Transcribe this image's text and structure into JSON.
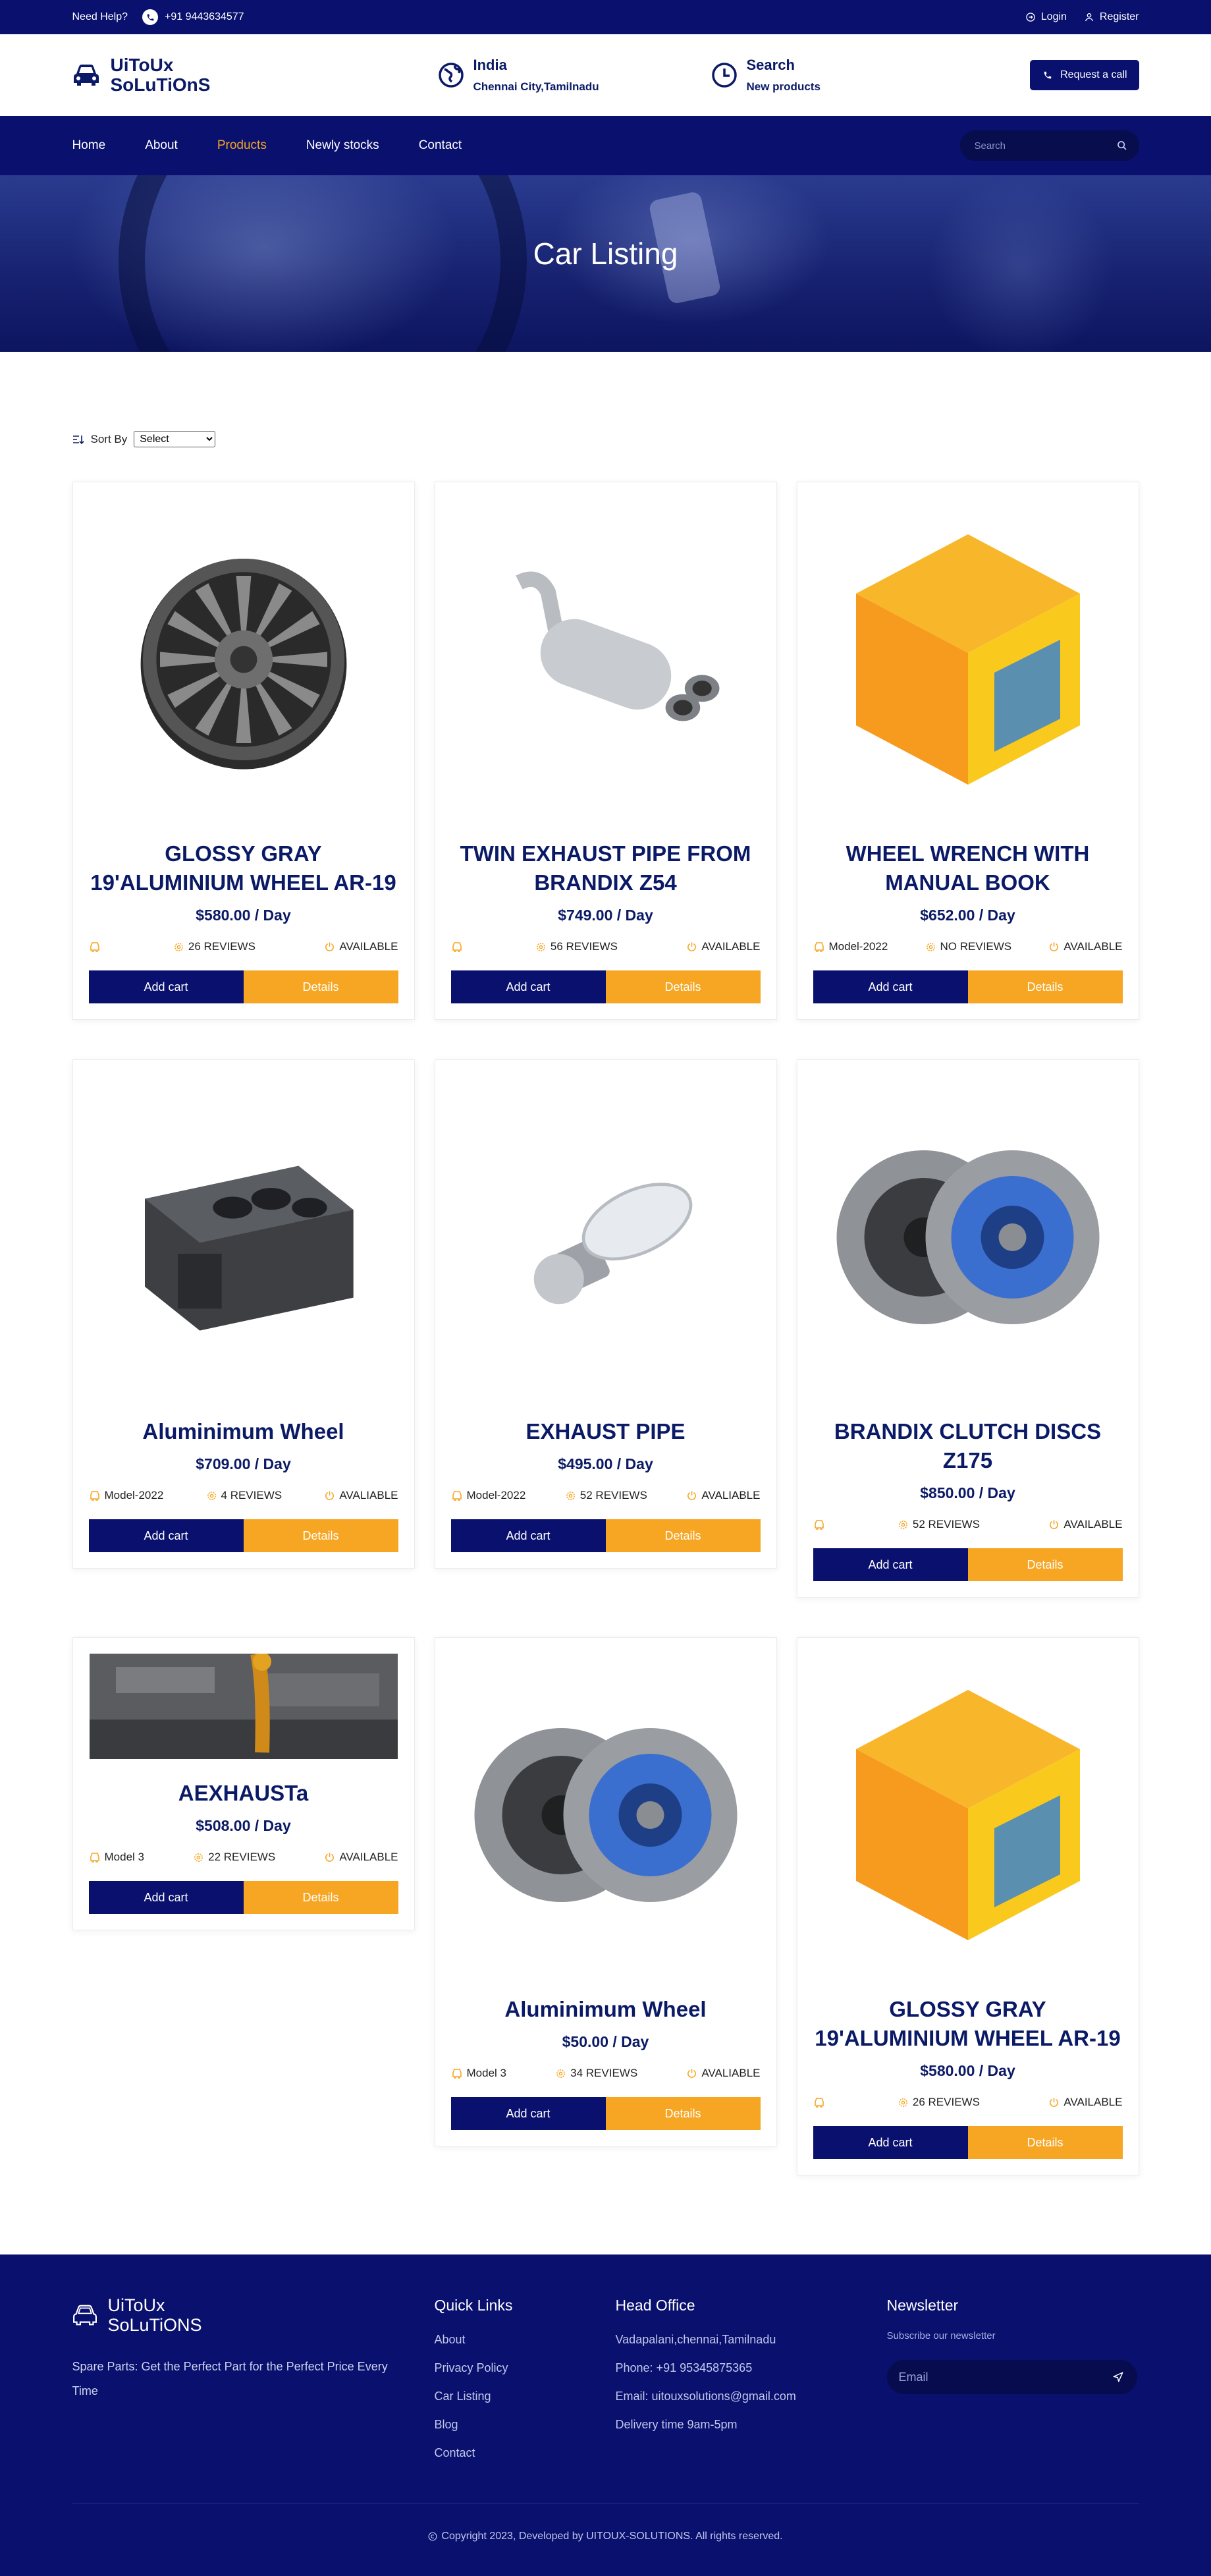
{
  "topbar": {
    "help_label": "Need Help?",
    "phone": "+91 9443634577",
    "login_label": "Login",
    "register_label": "Register"
  },
  "header": {
    "logo_line1": "UiToUx",
    "logo_line2": "SoLuTiOnS",
    "location_title": "India",
    "location_sub": "Chennai City,Tamilnadu",
    "search_title": "Search",
    "search_sub": "New products",
    "request_label": "Request a call"
  },
  "nav": {
    "items": [
      {
        "label": "Home",
        "active": false
      },
      {
        "label": "About",
        "active": false
      },
      {
        "label": "Products",
        "active": true
      },
      {
        "label": "Newly stocks",
        "active": false
      },
      {
        "label": "Contact",
        "active": false
      }
    ],
    "search_placeholder": "Search"
  },
  "banner": {
    "title": "Car Listing"
  },
  "sort": {
    "label": "Sort By",
    "selected": "Select"
  },
  "products": [
    {
      "name": "GLOSSY GRAY 19'ALUMINIUM WHEEL AR-19",
      "price": "$580.00 / Day",
      "model": "",
      "reviews": "26 REVIEWS",
      "status": "AVAILABLE",
      "image": "alloy-wheel"
    },
    {
      "name": "TWIN EXHAUST PIPE FROM BRANDIX Z54",
      "price": "$749.00 / Day",
      "model": "",
      "reviews": "56 REVIEWS",
      "status": "AVAILABLE",
      "image": "exhaust-pipe"
    },
    {
      "name": "WHEEL WRENCH WITH MANUAL BOOK",
      "price": "$652.00 / Day",
      "model": "Model-2022",
      "reviews": "NO REVIEWS",
      "status": "AVAILABLE",
      "image": "box-placeholder"
    },
    {
      "name": "Aluminimum Wheel",
      "price": "$709.00 / Day",
      "model": "Model-2022",
      "reviews": "4 REVIEWS",
      "status": "AVALIABLE",
      "image": "engine-block"
    },
    {
      "name": "EXHAUST PIPE",
      "price": "$495.00 / Day",
      "model": "Model-2022",
      "reviews": "52 REVIEWS",
      "status": "AVALIABLE",
      "image": "headlight-bulb"
    },
    {
      "name": "BRANDIX CLUTCH DISCS Z175",
      "price": "$850.00 / Day",
      "model": "",
      "reviews": "52 REVIEWS",
      "status": "AVAILABLE",
      "image": "clutch-discs"
    },
    {
      "name": "AEXHAUSTa",
      "price": "$508.00 / Day",
      "model": "Model 3",
      "reviews": "22 REVIEWS",
      "status": "AVAILABLE",
      "image": "engine-oil"
    },
    {
      "name": "Aluminimum Wheel",
      "price": "$50.00 / Day",
      "model": "Model 3",
      "reviews": "34 REVIEWS",
      "status": "AVALIABLE",
      "image": "clutch-discs"
    },
    {
      "name": "GLOSSY GRAY 19'ALUMINIUM WHEEL AR-19",
      "price": "$580.00 / Day",
      "model": "",
      "reviews": "26 REVIEWS",
      "status": "AVAILABLE",
      "image": "box-placeholder"
    }
  ],
  "buttons": {
    "add_cart": "Add cart",
    "details": "Details"
  },
  "footer": {
    "logo_line1": "UiToUx",
    "logo_line2": "SoLuTiONS",
    "description": "Spare Parts: Get the Perfect Part for the Perfect Price Every Time",
    "quick_links_title": "Quick Links",
    "quick_links": [
      "About",
      "Privacy Policy",
      "Car Listing",
      "Blog",
      "Contact"
    ],
    "head_office_title": "Head Office",
    "head_office": [
      "Vadapalani,chennai,Tamilnadu",
      "Phone: +91 95345875365",
      "Email: uitouxsolutions@gmail.com",
      "Delivery time 9am-5pm"
    ],
    "newsletter_title": "Newsletter",
    "newsletter_sub": "Subscribe our newsletter",
    "email_placeholder": "Email",
    "copyright": "Copyright 2023, Developed by UITOUX-SOLUTIONS. All rights reserved."
  },
  "colors": {
    "primary": "#09106e",
    "accent": "#f6a623"
  }
}
